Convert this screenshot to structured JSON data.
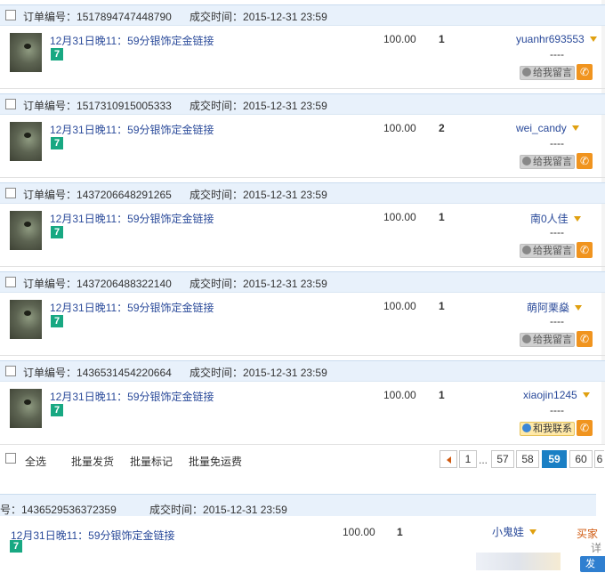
{
  "labels": {
    "order_no": "订单编号：",
    "deal_time": "成交时间：",
    "leave_msg": "给我留言",
    "contact_me": "和我联系",
    "dash": "----"
  },
  "orders": [
    {
      "order_no": "1517894747448790",
      "deal_time": "2015-12-31 23:59",
      "title": "12月31日晚11：59分银饰定金链接",
      "badge": "7",
      "price": "100.00",
      "qty": "1",
      "buyer": "yuanhr693553",
      "message_btn": "给我留言"
    },
    {
      "order_no": "1517310915005333",
      "deal_time": "2015-12-31 23:59",
      "title": "12月31日晚11：59分银饰定金链接",
      "badge": "7",
      "price": "100.00",
      "qty": "2",
      "buyer": "wei_candy",
      "message_btn": "给我留言"
    },
    {
      "order_no": "1437206648291265",
      "deal_time": "2015-12-31 23:59",
      "title": "12月31日晚11：59分银饰定金链接",
      "badge": "7",
      "price": "100.00",
      "qty": "1",
      "buyer": "南0人佳",
      "message_btn": "给我留言"
    },
    {
      "order_no": "1437206488322140",
      "deal_time": "2015-12-31 23:59",
      "title": "12月31日晚11：59分银饰定金链接",
      "badge": "7",
      "price": "100.00",
      "qty": "1",
      "buyer": "萌阿栗燊",
      "message_btn": "给我留言"
    },
    {
      "order_no": "1436531454220664",
      "deal_time": "2015-12-31 23:59",
      "title": "12月31日晚11：59分银饰定金链接",
      "badge": "7",
      "price": "100.00",
      "qty": "1",
      "buyer": "xiaojin1245",
      "message_btn": "和我联系"
    }
  ],
  "footer": {
    "select_all": "全选",
    "batch_ship": "批量发货",
    "batch_mark": "批量标记",
    "batch_free_shipping": "批量免运费",
    "pages": [
      "1",
      "...",
      "57",
      "58",
      "59",
      "60",
      "6"
    ],
    "current_page": "59"
  },
  "partial_order": {
    "order_no": "号：1436529536372359",
    "deal_time_label": "成交时间：",
    "deal_time": "2015-12-31 23:59",
    "title": "12月31日晚11：59分银饰定金链接",
    "badge": "7",
    "price": "100.00",
    "qty": "1",
    "buyer": "小鬼娃",
    "side_text": "买家",
    "side_text2": "详",
    "side_btn": "发"
  },
  "colors": {
    "header_bg": "#e8f1fb",
    "link_blue": "#2a4a9a",
    "badge_green": "#18a882",
    "phone_orange": "#f0941f",
    "current_page_blue": "#1a7fc4"
  }
}
